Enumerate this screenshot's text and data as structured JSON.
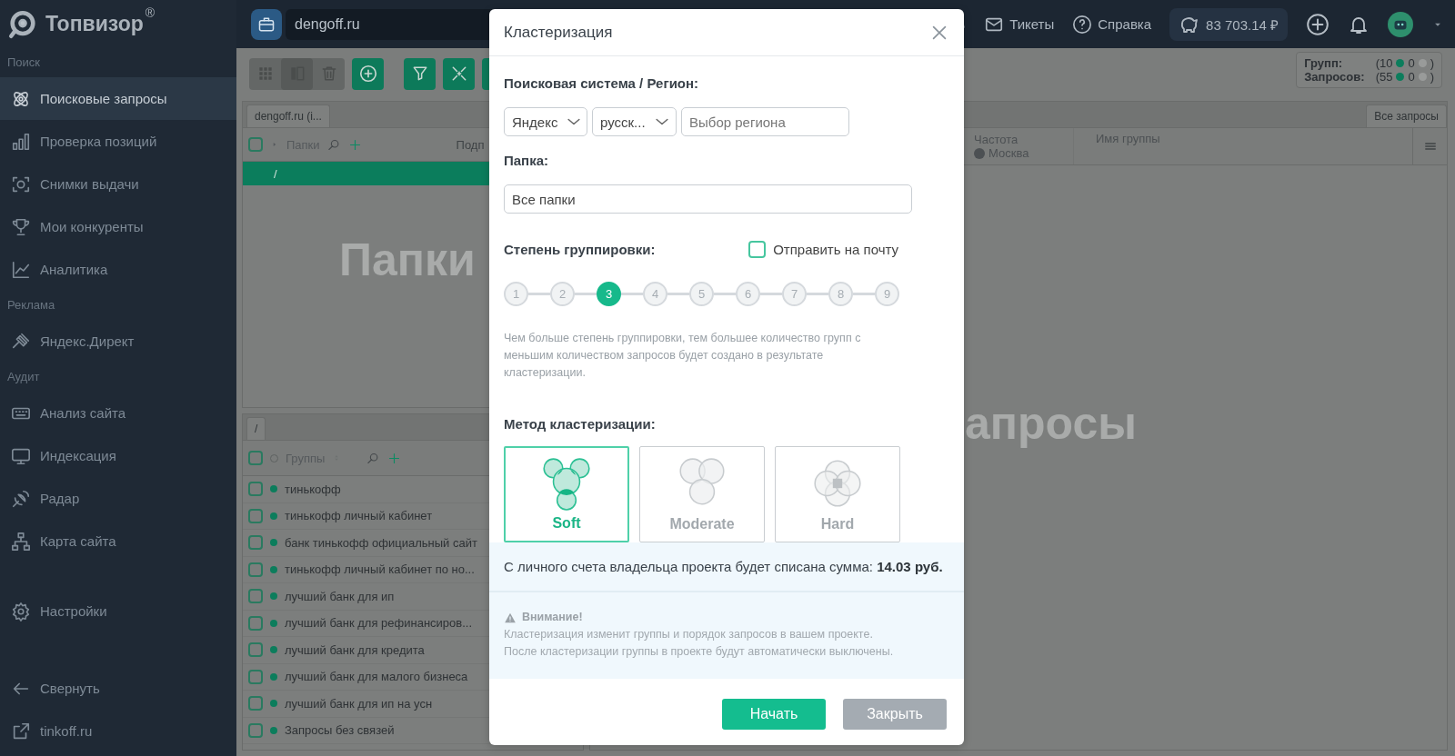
{
  "logo": {
    "name": "Топвизор",
    "mark": "®"
  },
  "project": {
    "name": "dengoff.ru"
  },
  "topbar": {
    "tickets": "Тикеты",
    "help": "Справка",
    "balance": "83 703.14 ₽"
  },
  "sidebar": {
    "sections": [
      {
        "title": "Поиск",
        "items": [
          {
            "label": "Поисковые запросы",
            "selected": true
          },
          {
            "label": "Проверка позиций",
            "selected": false
          },
          {
            "label": "Снимки выдачи",
            "selected": false
          },
          {
            "label": "Мои конкуренты",
            "selected": false
          },
          {
            "label": "Аналитика",
            "selected": false
          }
        ]
      },
      {
        "title": "Реклама",
        "items": [
          {
            "label": "Яндекс.Директ",
            "selected": false
          }
        ]
      },
      {
        "title": "Аудит",
        "items": [
          {
            "label": "Анализ сайта",
            "selected": false
          },
          {
            "label": "Индексация",
            "selected": false
          },
          {
            "label": "Радар",
            "selected": false
          },
          {
            "label": "Карта сайта",
            "selected": false
          }
        ]
      }
    ],
    "settings": {
      "label": "Настройки",
      "selected": false
    },
    "collapse": "Свернуть",
    "site_link": "tinkoff.ru"
  },
  "toolbar": {
    "views": [
      {
        "selected": false
      },
      {
        "selected": true
      }
    ]
  },
  "stats": [
    {
      "label": "Групп:",
      "open": "(10",
      "active": "0",
      "close": ")"
    },
    {
      "label": "Запросов:",
      "open": "(55",
      "active": "0",
      "close": ")"
    }
  ],
  "folders_panel": {
    "tab": "dengoff.ru (i...",
    "header": "Папки",
    "all_checked": false,
    "header_cut": "Подп",
    "rows": [
      {
        "label": "/",
        "selected": true
      }
    ],
    "empty_text": "Папки"
  },
  "groups_panel": {
    "tab": "/",
    "header": "Группы",
    "all_checked": false,
    "rows": [
      {
        "label": "тинькофф",
        "checked": false
      },
      {
        "label": "тинькофф личный кабинет",
        "checked": false
      },
      {
        "label": "банк тинькофф официальный сайт",
        "checked": false
      },
      {
        "label": "тинькофф личный кабинет по но...",
        "checked": false
      },
      {
        "label": "лучший банк для ип",
        "checked": false
      },
      {
        "label": "лучший банк для рефинансиров...",
        "checked": false
      },
      {
        "label": "лучший банк для кредита",
        "checked": false
      },
      {
        "label": "лучший банк для малого бизнеса",
        "checked": false
      },
      {
        "label": "лучший банк для ип на усн",
        "checked": false
      },
      {
        "label": "Запросы без связей",
        "checked": false
      }
    ]
  },
  "queries_panel": {
    "tab": "Все запросы",
    "columns": [
      {
        "label": "Частота",
        "sub": "Москва"
      },
      {
        "label": "Имя группы"
      }
    ],
    "empty_text": "апросы"
  },
  "dialog": {
    "title": "Кластеризация",
    "engine_label": "Поисковая система / Регион:",
    "engine": "Яндекс",
    "language": "русск...",
    "region_placeholder": "Выбор региона",
    "folder_label": "Папка:",
    "folder": "Все папки",
    "degree_label": "Степень группировки:",
    "email": {
      "label": "Отправить на почту",
      "checked": false
    },
    "degrees": [
      {
        "label": "1",
        "selected": false
      },
      {
        "label": "2",
        "selected": false
      },
      {
        "label": "3",
        "selected": true
      },
      {
        "label": "4",
        "selected": false
      },
      {
        "label": "5",
        "selected": false
      },
      {
        "label": "6",
        "selected": false
      },
      {
        "label": "7",
        "selected": false
      },
      {
        "label": "8",
        "selected": false
      },
      {
        "label": "9",
        "selected": false
      }
    ],
    "degree_hint": "Чем больше степень группировки, тем большее количество групп с меньшим количеством запросов будет создано в результате кластеризации.",
    "method_label": "Метод кластеризации:",
    "methods": [
      {
        "label": "Soft",
        "selected": true
      },
      {
        "label": "Moderate",
        "selected": false
      },
      {
        "label": "Hard",
        "selected": false
      }
    ],
    "cost": "С личного счета владельца проекта будет списана сумма: **14.03 руб.**",
    "warning": {
      "title": "Внимание!",
      "lines": [
        "Кластеризация изменит группы и порядок запросов в вашем проекте.",
        "После кластеризации группы в проекте будут автоматически выключены."
      ]
    },
    "buttons": [
      {
        "label": "Начать",
        "kind": "primary"
      },
      {
        "label": "Закрыть",
        "kind": "secondary"
      }
    ]
  }
}
